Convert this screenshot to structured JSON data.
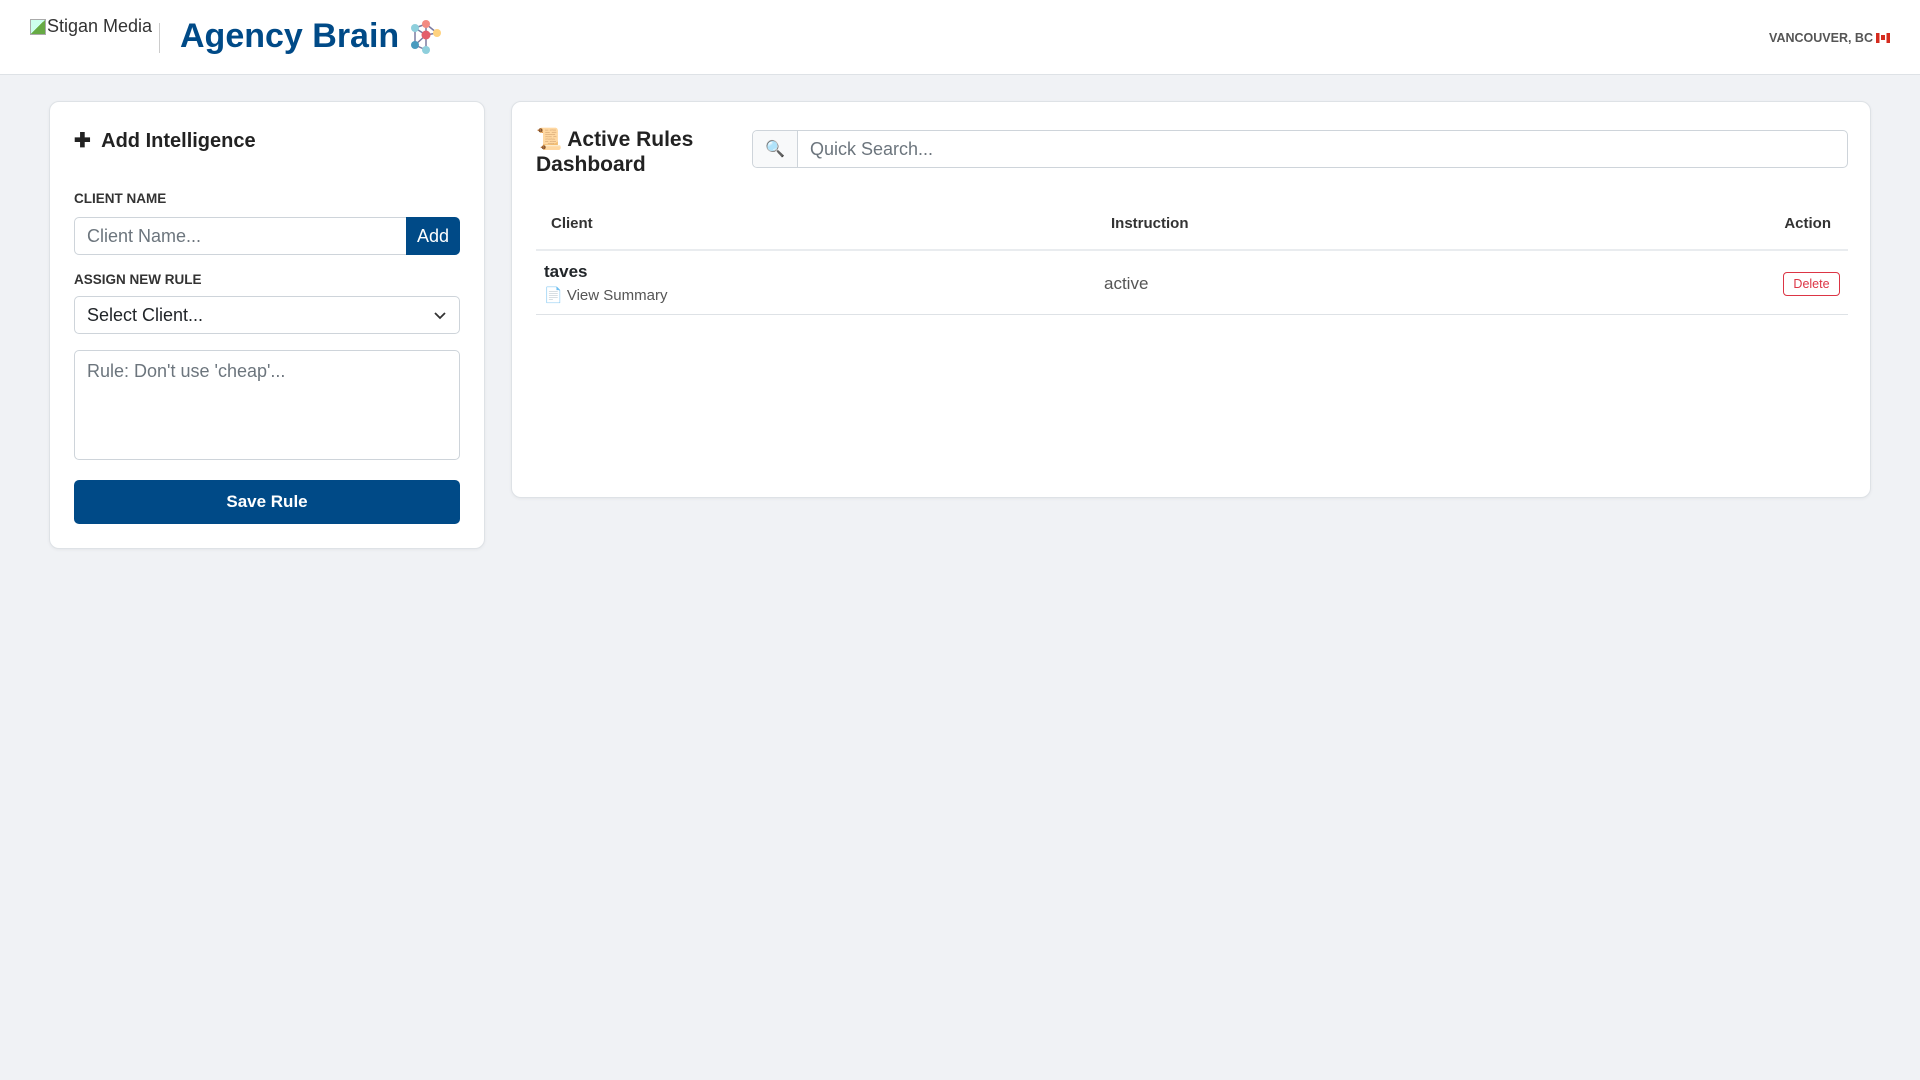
{
  "header": {
    "logo_alt": "Stigan Media",
    "brand": "Agency Brain",
    "location": "VANCOUVER, BC"
  },
  "add_panel": {
    "title": "Add Intelligence",
    "client_name_label": "CLIENT NAME",
    "client_name_placeholder": "Client Name...",
    "add_button": "Add",
    "assign_label": "ASSIGN NEW RULE",
    "select_value": "Select Client...",
    "rule_placeholder": "Rule: Don't use 'cheap'...",
    "save_button": "Save Rule"
  },
  "dashboard": {
    "title": "Active Rules Dashboard",
    "search_placeholder": "Quick Search...",
    "columns": [
      "Client",
      "Instruction",
      "Action"
    ],
    "rows": [
      {
        "client": "taves",
        "summary_link": "View Summary",
        "instruction": "active",
        "action": "Delete"
      }
    ]
  },
  "colors": {
    "brand": "#004a87",
    "danger": "#dc3545",
    "background": "#f0f2f5"
  }
}
